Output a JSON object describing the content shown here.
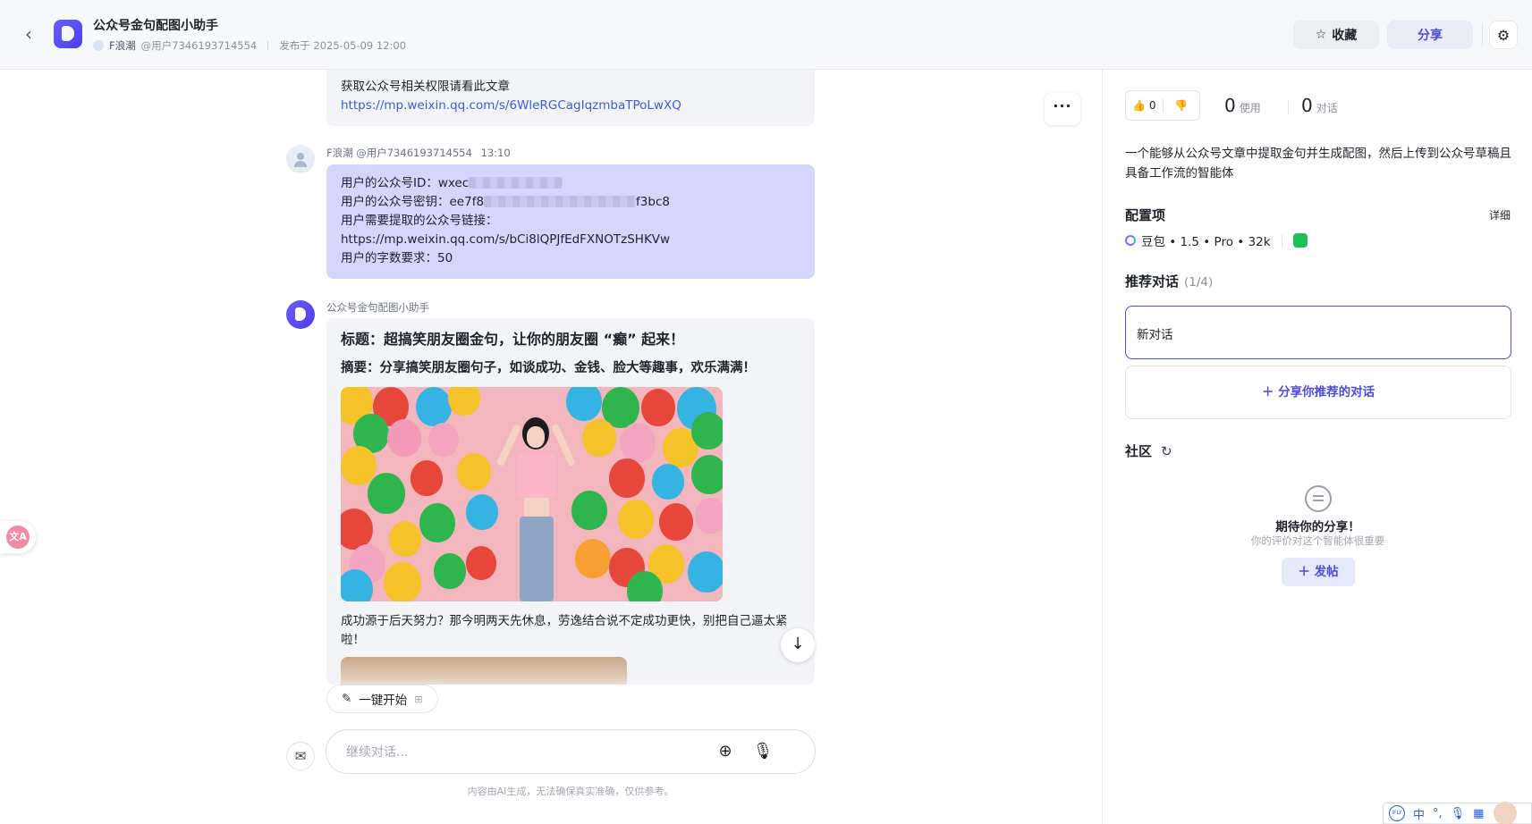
{
  "header": {
    "back_icon": "chevron-left-icon",
    "title": "公众号金句配图小助手",
    "author": "F浪潮",
    "handle": "@用户7346193714554",
    "published": "发布于 2025-05-09 12:00",
    "favorite_label": "收藏",
    "share_label": "分享"
  },
  "chat": {
    "prev_message": {
      "line1": "获取公众号相关权限请看此文章",
      "link": "https://mp.weixin.qq.com/s/6WleRGCagIqzmbaTPoLwXQ"
    },
    "user_message": {
      "author": "F浪潮",
      "handle": "@用户7346193714554",
      "time": "13:10",
      "line1_prefix": "用户的公众号ID：wxec",
      "line2_prefix": "用户的公众号密钥：ee7f8",
      "line2_suffix": "f3bc8",
      "line3": "用户需要提取的公众号链接：",
      "line4": "https://mp.weixin.qq.com/s/bCi8lQPJfEdFXNOTzSHKVw",
      "line5": "用户的字数要求：50"
    },
    "bot_message": {
      "name": "公众号金句配图小助手",
      "title": "标题：超搞笑朋友圈金句，让你的朋友圈 “癫” 起来！",
      "summary": "摘要：分享搞笑朋友圈句子，如谈成功、金钱、脸大等趣事，欢乐满满！",
      "paragraph": "成功源于后天努力？那今明两天先休息，劳逸结合说不定成功更快，别把自己逼太紧啦！"
    },
    "quick_start_label": "一键开始",
    "input_placeholder": "继续对话...",
    "disclaimer": "内容由AI生成，无法确保真实准确，仅供参考。"
  },
  "panel": {
    "likes": "0",
    "usage_count": "0",
    "usage_label": "使用",
    "chat_count": "0",
    "chat_label": "对话",
    "description": "一个能够从公众号文章中提取金句并生成配图，然后上传到公众号草稿且具备工作流的智能体",
    "config_title": "配置项",
    "detail_label": "详细",
    "model": "豆包 • 1.5 • Pro • 32k",
    "recommended_title": "推荐对话",
    "recommended_count": "(1/4)",
    "recommended_item": "新对话",
    "share_recommend_label": "分享你推荐的对话",
    "community_title": "社区",
    "empty_title": "期待你的分享！",
    "empty_sub": "你的评价对这个智能体很重要",
    "post_label": "发帖"
  },
  "ime": {
    "logo_text": "iFLY",
    "lang": "中"
  },
  "colors": {
    "accent": "#4b4be0",
    "user_bubble": "#d4d6fd",
    "bot_bubble": "#f3f4f7",
    "link": "#3b5bdb"
  }
}
